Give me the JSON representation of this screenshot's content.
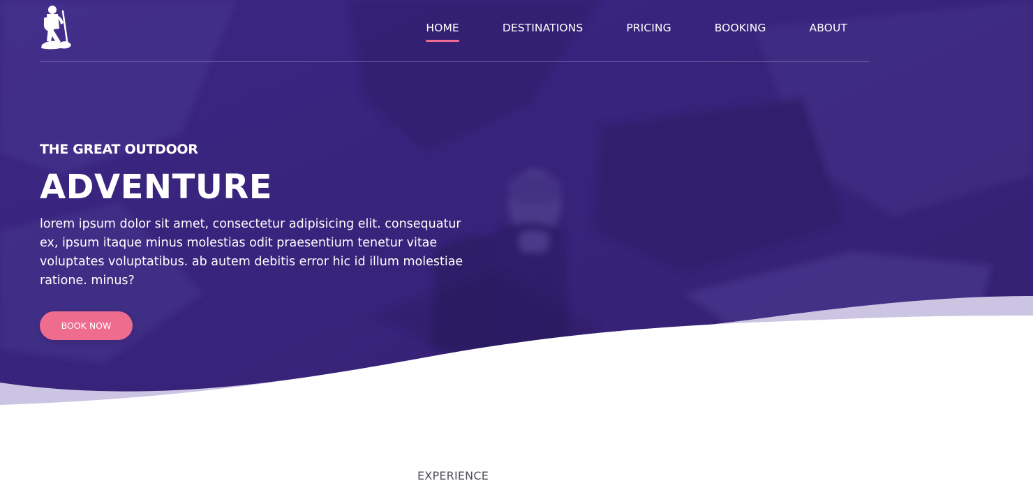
{
  "header": {
    "nav_items": [
      {
        "label": "HOME",
        "active": true
      },
      {
        "label": "DESTINATIONS",
        "active": false
      },
      {
        "label": "PRICING",
        "active": false
      },
      {
        "label": "BOOKING",
        "active": false
      },
      {
        "label": "ABOUT",
        "active": false
      }
    ],
    "logo_icon": "hiker-icon"
  },
  "hero": {
    "subtitle": "THE GREAT OUTDOOR",
    "title": "ADVENTURE",
    "description": "lorem ipsum dolor sit amet, consectetur adipisicing elit. consequatur ex, ipsum itaque minus molestias odit praesentium tenetur vitae voluptates voluptatibus. ab autem debitis error hic id illum molestiae ratione. minus?",
    "button_label": "BOOK NOW"
  },
  "section": {
    "label": "EXPERIENCE"
  },
  "colors": {
    "hero_overlay": "#3b2684",
    "accent": "#ee6c8e",
    "wave_light": "#cbc4e2",
    "text_light": "#ffffff",
    "text_dark": "#4d4d57"
  }
}
